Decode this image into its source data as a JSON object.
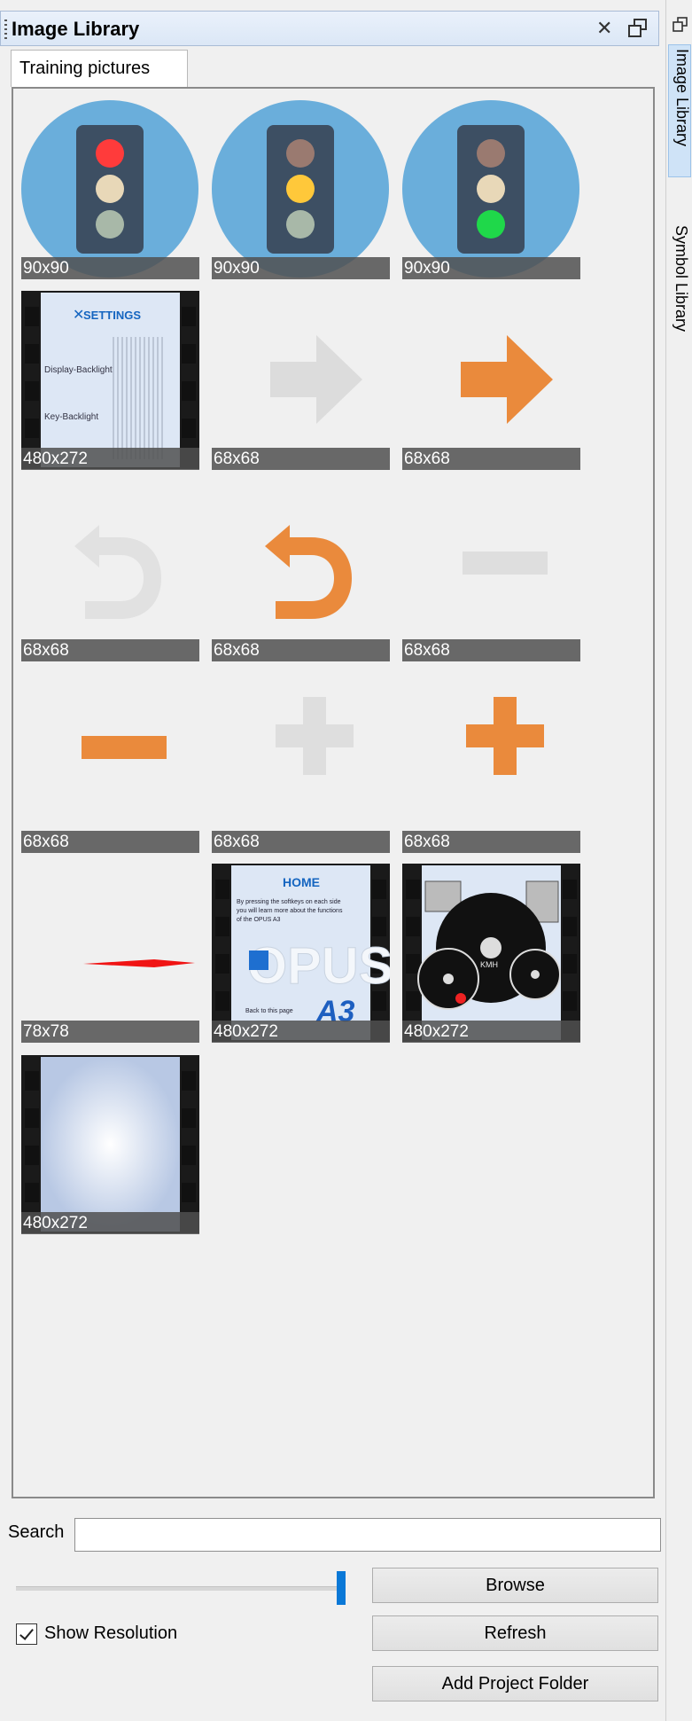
{
  "panel": {
    "title": "Image Library",
    "tab": "Training pictures"
  },
  "thumbnails": [
    {
      "resolution": "90x90",
      "art": "traffic-light-red"
    },
    {
      "resolution": "90x90",
      "art": "traffic-light-yellow"
    },
    {
      "resolution": "90x90",
      "art": "traffic-light-green"
    },
    {
      "resolution": "480x272",
      "art": "screen-settings",
      "screen_title": "SETTINGS",
      "lines": [
        "Display-Backlight",
        "Key-Backlight"
      ]
    },
    {
      "resolution": "68x68",
      "art": "arrow-right-gray"
    },
    {
      "resolution": "68x68",
      "art": "arrow-right-orange"
    },
    {
      "resolution": "68x68",
      "art": "back-arrow-gray"
    },
    {
      "resolution": "68x68",
      "art": "back-arrow-orange"
    },
    {
      "resolution": "68x68",
      "art": "minus-gray"
    },
    {
      "resolution": "68x68",
      "art": "minus-orange"
    },
    {
      "resolution": "68x68",
      "art": "plus-gray"
    },
    {
      "resolution": "68x68",
      "art": "plus-orange"
    },
    {
      "resolution": "78x78",
      "art": "needle-red"
    },
    {
      "resolution": "480x272",
      "art": "screen-home",
      "screen_title": "HOME",
      "lines": [
        "By pressing the softkeys on each side",
        "you will learn more about the functions",
        "of the OPUS A3",
        "Back to this page"
      ],
      "brand": "OPUS",
      "model": "A3"
    },
    {
      "resolution": "480x272",
      "art": "screen-gauges",
      "gauge_label": "KMH"
    },
    {
      "resolution": "480x272",
      "art": "screen-blank"
    }
  ],
  "search": {
    "label": "Search",
    "value": ""
  },
  "zoom_slider": {
    "value": 1.0
  },
  "show_resolution": {
    "label": "Show Resolution",
    "checked": true
  },
  "buttons": {
    "browse": "Browse",
    "refresh": "Refresh",
    "add_folder": "Add Project Folder"
  },
  "side_tabs": [
    "Image Library",
    "Symbol Library"
  ],
  "icons": {
    "close": "close-icon",
    "float": "float-window-icon",
    "grip": "grip-icon"
  }
}
